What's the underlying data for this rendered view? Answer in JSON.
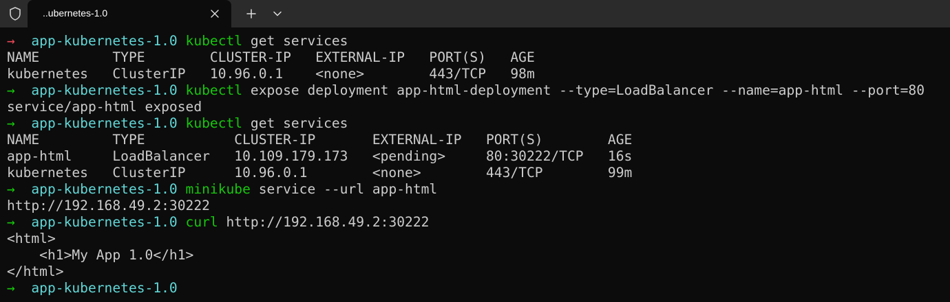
{
  "window": {
    "tab_title": "..ubernetes-1.0",
    "icons": {
      "shield": "shield-icon",
      "close": "close-icon",
      "new_tab": "plus-icon",
      "menu": "chevron-down-icon"
    }
  },
  "colors": {
    "background": "#0c0c0c",
    "titlebar": "#2b2b2b",
    "prompt_arrow_ok": "#16c60c",
    "prompt_arrow_error": "#e74856",
    "prompt_dir": "#61d6d6",
    "command": "#16c60c",
    "text": "#cccccc"
  },
  "terminal": {
    "lines": [
      {
        "type": "prompt",
        "arrow": "→",
        "error": true,
        "dir": "app-kubernetes-1.0",
        "cmd": "kubectl",
        "args": " get services"
      },
      {
        "type": "output",
        "text": "NAME         TYPE        CLUSTER-IP   EXTERNAL-IP   PORT(S)   AGE"
      },
      {
        "type": "output",
        "text": "kubernetes   ClusterIP   10.96.0.1    <none>        443/TCP   98m"
      },
      {
        "type": "prompt",
        "arrow": "→",
        "error": false,
        "dir": "app-kubernetes-1.0",
        "cmd": "kubectl",
        "args": " expose deployment app-html-deployment --type=LoadBalancer --name=app-html --port=80"
      },
      {
        "type": "output",
        "text": "service/app-html exposed"
      },
      {
        "type": "prompt",
        "arrow": "→",
        "error": false,
        "dir": "app-kubernetes-1.0",
        "cmd": "kubectl",
        "args": " get services"
      },
      {
        "type": "output",
        "text": "NAME         TYPE           CLUSTER-IP       EXTERNAL-IP   PORT(S)        AGE"
      },
      {
        "type": "output",
        "text": "app-html     LoadBalancer   10.109.179.173   <pending>     80:30222/TCP   16s"
      },
      {
        "type": "output",
        "text": "kubernetes   ClusterIP      10.96.0.1        <none>        443/TCP        99m"
      },
      {
        "type": "prompt",
        "arrow": "→",
        "error": false,
        "dir": "app-kubernetes-1.0",
        "cmd": "minikube",
        "args": " service --url app-html"
      },
      {
        "type": "output",
        "text": "http://192.168.49.2:30222"
      },
      {
        "type": "prompt",
        "arrow": "→",
        "error": false,
        "dir": "app-kubernetes-1.0",
        "cmd": "curl",
        "args": " http://192.168.49.2:30222"
      },
      {
        "type": "output",
        "text": "<html>"
      },
      {
        "type": "output",
        "text": "    <h1>My App 1.0</h1>"
      },
      {
        "type": "output",
        "text": "</html>"
      },
      {
        "type": "prompt",
        "arrow": "→",
        "error": false,
        "dir": "app-kubernetes-1.0",
        "cmd": "",
        "args": ""
      }
    ]
  }
}
